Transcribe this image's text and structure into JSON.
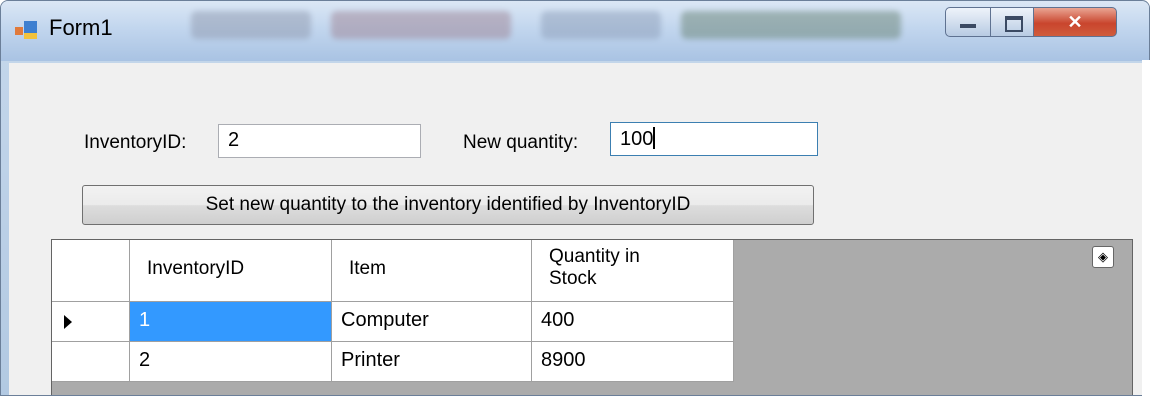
{
  "window": {
    "title": "Form1"
  },
  "form": {
    "inventory_id_label": "InventoryID:",
    "inventory_id_value": "2",
    "new_quantity_label": "New quantity:",
    "new_quantity_value": "100",
    "set_button_label": "Set new quantity to the inventory identified by InventoryID"
  },
  "grid": {
    "columns": [
      "InventoryID",
      "Item",
      "Quantity in\nStock"
    ],
    "rows": [
      {
        "id": "1",
        "item": "Computer",
        "qty": "400",
        "current": true,
        "selected_cell": "id"
      },
      {
        "id": "2",
        "item": "Printer",
        "qty": "8900",
        "current": false
      }
    ]
  },
  "colors": {
    "selection": "#3399ff",
    "grid_background": "#ababab",
    "form_background": "#f0f0f0"
  },
  "icons": {
    "app": "form-app-icon",
    "minimize": "minimize-icon",
    "maximize": "maximize-icon",
    "close": "close-icon",
    "row_indicator": "current-row-arrow-icon",
    "corner": "layers-icon"
  }
}
